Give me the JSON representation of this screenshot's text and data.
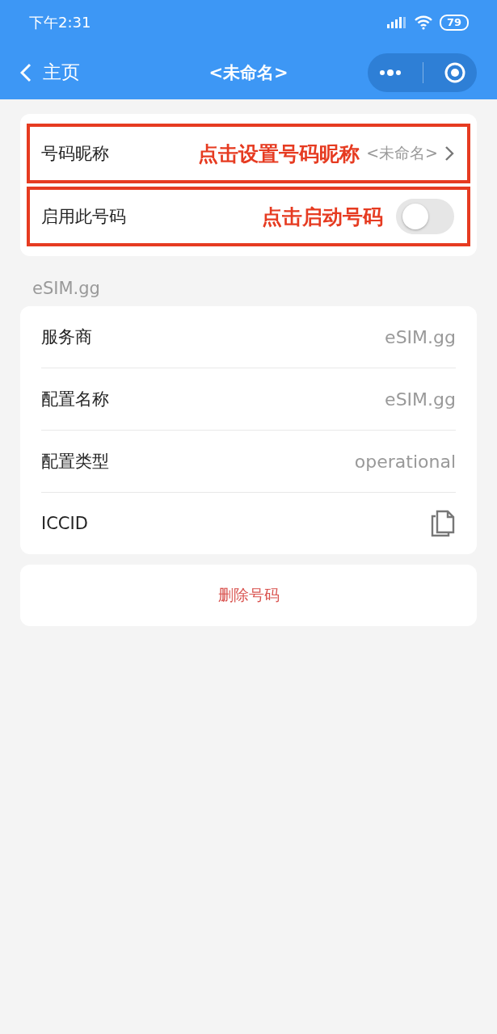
{
  "status_bar": {
    "time": "下午2:31",
    "battery": "79"
  },
  "nav": {
    "back_label": "主页",
    "title": "<未命名>"
  },
  "settings": [
    {
      "kind": "link",
      "label": "号码昵称",
      "annotation": "点击设置号码昵称",
      "value": "<未命名>"
    },
    {
      "kind": "toggle",
      "label": "启用此号码",
      "annotation": "点击启动号码",
      "on": false
    }
  ],
  "section_title": "eSIM.gg",
  "details": [
    {
      "kind": "text",
      "label": "服务商",
      "value": "eSIM.gg"
    },
    {
      "kind": "text",
      "label": "配置名称",
      "value": "eSIM.gg"
    },
    {
      "kind": "text",
      "label": "配置类型",
      "value": "operational"
    },
    {
      "kind": "copy",
      "label": "ICCID"
    }
  ],
  "delete_button": "删除号码"
}
